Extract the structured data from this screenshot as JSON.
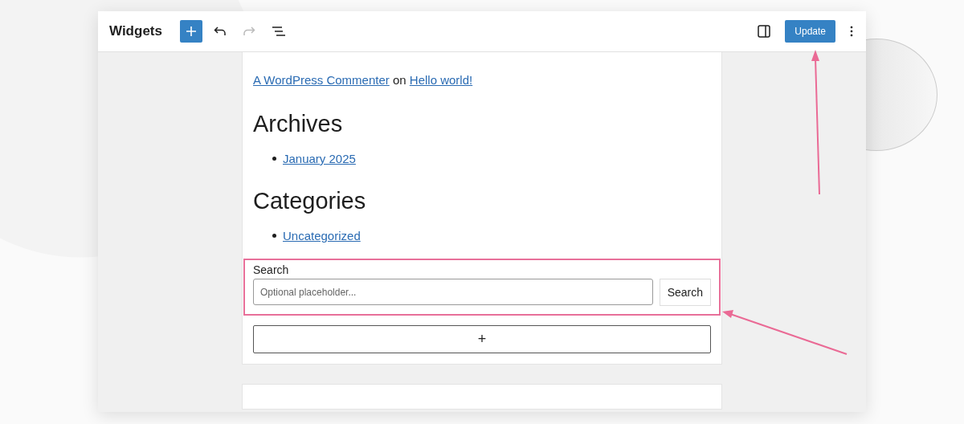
{
  "window": {
    "title": "Widgets"
  },
  "toolbar": {
    "undo": {
      "disabled": false
    },
    "redo": {
      "disabled": true
    },
    "update_button": "Update"
  },
  "comment": {
    "author": "A WordPress Commenter",
    "joiner": "on",
    "post": "Hello world!"
  },
  "sections": [
    {
      "heading": "Archives",
      "items": [
        "January 2025"
      ]
    },
    {
      "heading": "Categories",
      "items": [
        "Uncategorized"
      ]
    }
  ],
  "search_widget": {
    "label": "Search",
    "placeholder": "Optional placeholder...",
    "button": "Search"
  },
  "add_block_button": "+"
}
